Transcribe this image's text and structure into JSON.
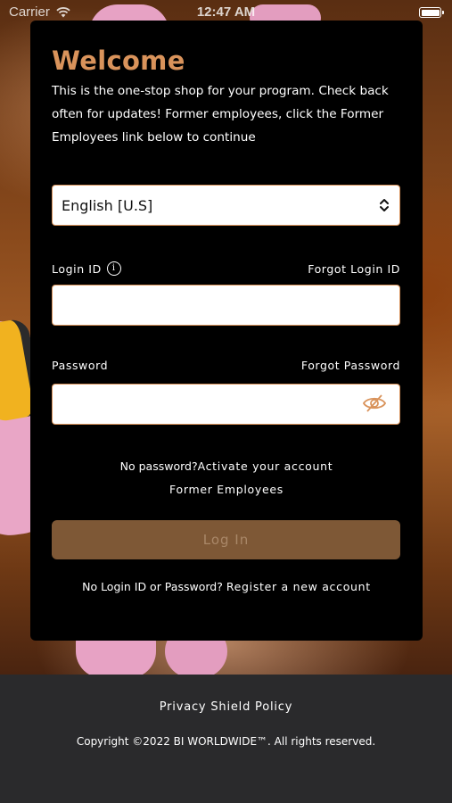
{
  "status_bar": {
    "carrier": "Carrier",
    "time": "12:47 AM"
  },
  "login": {
    "title": "Welcome",
    "intro": "This is the one-stop shop for your program. Check back often for updates! Former employees, click the Former Employees link below to continue",
    "language": {
      "selected": "English [U.S]",
      "icon": "updown-chevron-icon"
    },
    "login_id_label": "Login ID",
    "forgot_login_id": "Forgot Login ID",
    "login_id_value": "",
    "password_label": "Password",
    "forgot_password": "Forgot Password",
    "password_value": "",
    "no_password_text": "No password?",
    "activate_account": "Activate your account",
    "former_employees": "Former Employees",
    "login_button": "Log In",
    "no_login_text": "No Login ID or Password?",
    "register_account": "Register a new account"
  },
  "footer": {
    "privacy": "Privacy Shield Policy",
    "copyright": "Copyright ©2022 BI WORLDWIDE™. All rights reserved."
  },
  "colors": {
    "accent": "#d9935b",
    "button_bg": "#7e5836",
    "card_bg": "#000000",
    "footer_bg": "#2a2a2c"
  }
}
